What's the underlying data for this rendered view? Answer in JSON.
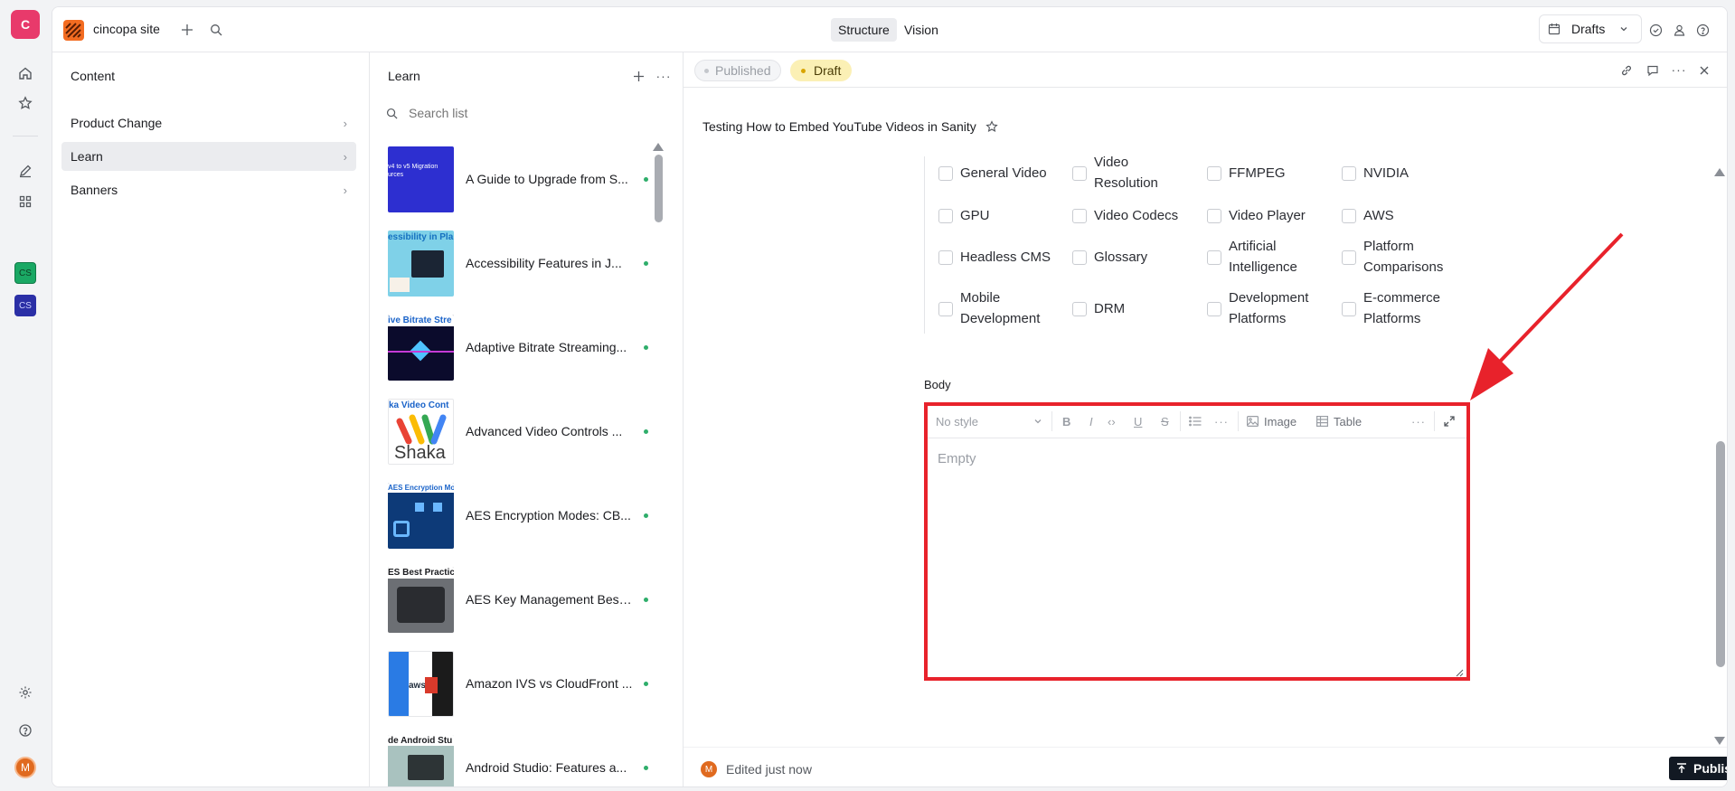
{
  "rail": {
    "workspace_initial": "C",
    "user_initial": "M",
    "ws1": "CS",
    "ws2": "CS"
  },
  "topbar": {
    "site_name": "cincopa site",
    "tabs": [
      "Structure",
      "Vision"
    ],
    "drafts_label": "Drafts"
  },
  "content_pane": {
    "title": "Content",
    "items": [
      "Product Change",
      "Learn",
      "Banners"
    ]
  },
  "learn_pane": {
    "title": "Learn",
    "search_placeholder": "Search list",
    "items": [
      {
        "title": "A Guide to Upgrade from S...",
        "thumb_text": "v4 to v5 Migration\nurces"
      },
      {
        "title": "Accessibility Features in J...",
        "thumb_text": "essibility in Pla"
      },
      {
        "title": "Adaptive Bitrate Streaming...",
        "thumb_text": "ive Bitrate Stre"
      },
      {
        "title": "Advanced Video Controls ...",
        "thumb_text": "ka Video Cont"
      },
      {
        "title": "AES Encryption Modes: CB...",
        "thumb_text": "AES Encryption Modes"
      },
      {
        "title": "AES Key Management Best...",
        "thumb_text": "ES Best Practice"
      },
      {
        "title": "Amazon IVS vs CloudFront ...",
        "thumb_text": "aws"
      },
      {
        "title": "Android Studio: Features a...",
        "thumb_text": "de Android Stu"
      }
    ]
  },
  "doc": {
    "status_published": "Published",
    "status_draft": "Draft",
    "title": "Testing How to Embed YouTube Videos in Sanity",
    "tags": [
      [
        "General Video",
        "Video Resolution",
        "FFMPEG",
        "NVIDIA"
      ],
      [
        "GPU",
        "Video Codecs",
        "Video Player",
        "AWS"
      ],
      [
        "Headless CMS",
        "Glossary",
        "Artificial Intelligence",
        "Platform Comparisons"
      ],
      [
        "Mobile Development",
        "DRM",
        "Development Platforms",
        "E-commerce Platforms"
      ]
    ],
    "body_label": "Body",
    "editor": {
      "style_select": "No style",
      "image_label": "Image",
      "table_label": "Table",
      "placeholder": "Empty"
    },
    "footer": {
      "edited": "Edited just now",
      "publish": "Publish"
    }
  },
  "colors": {
    "accent_red": "#e8222b",
    "brand_orange": "#f36c21",
    "draft_bg": "#fbf0b5",
    "green": "#2fae6b"
  }
}
